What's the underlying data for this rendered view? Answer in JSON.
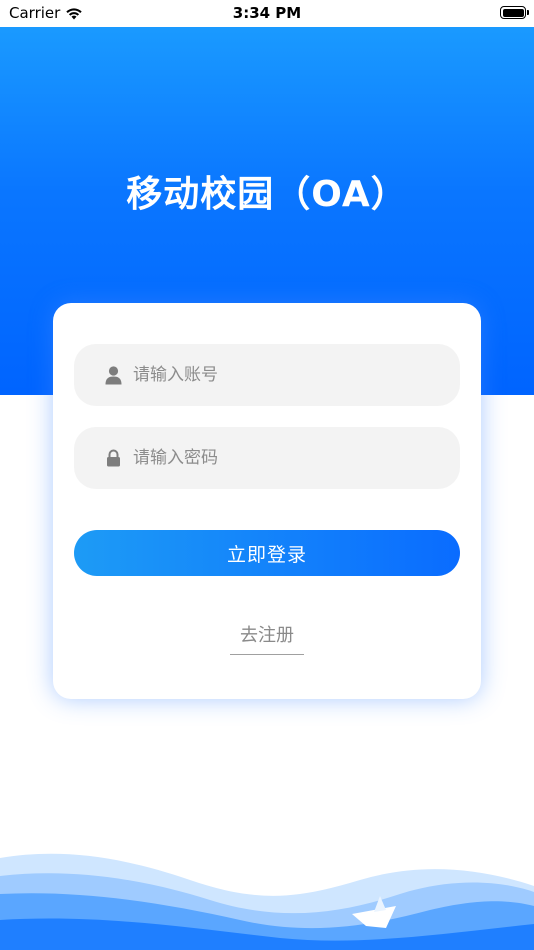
{
  "status_bar": {
    "carrier": "Carrier",
    "time": "3:34 PM"
  },
  "header": {
    "title": "移动校园（OA）"
  },
  "login_form": {
    "account_placeholder": "请输入账号",
    "password_placeholder": "请输入密码",
    "login_button_label": "立即登录",
    "register_link_label": "去注册"
  },
  "icons": {
    "wifi": "wifi-icon",
    "battery": "battery-icon",
    "user": "user-icon",
    "lock": "lock-icon",
    "boat": "paper-boat-icon"
  },
  "colors": {
    "brand_blue": "#0a76ff",
    "button_start": "#1d9bf6",
    "button_end": "#0a6cff"
  }
}
